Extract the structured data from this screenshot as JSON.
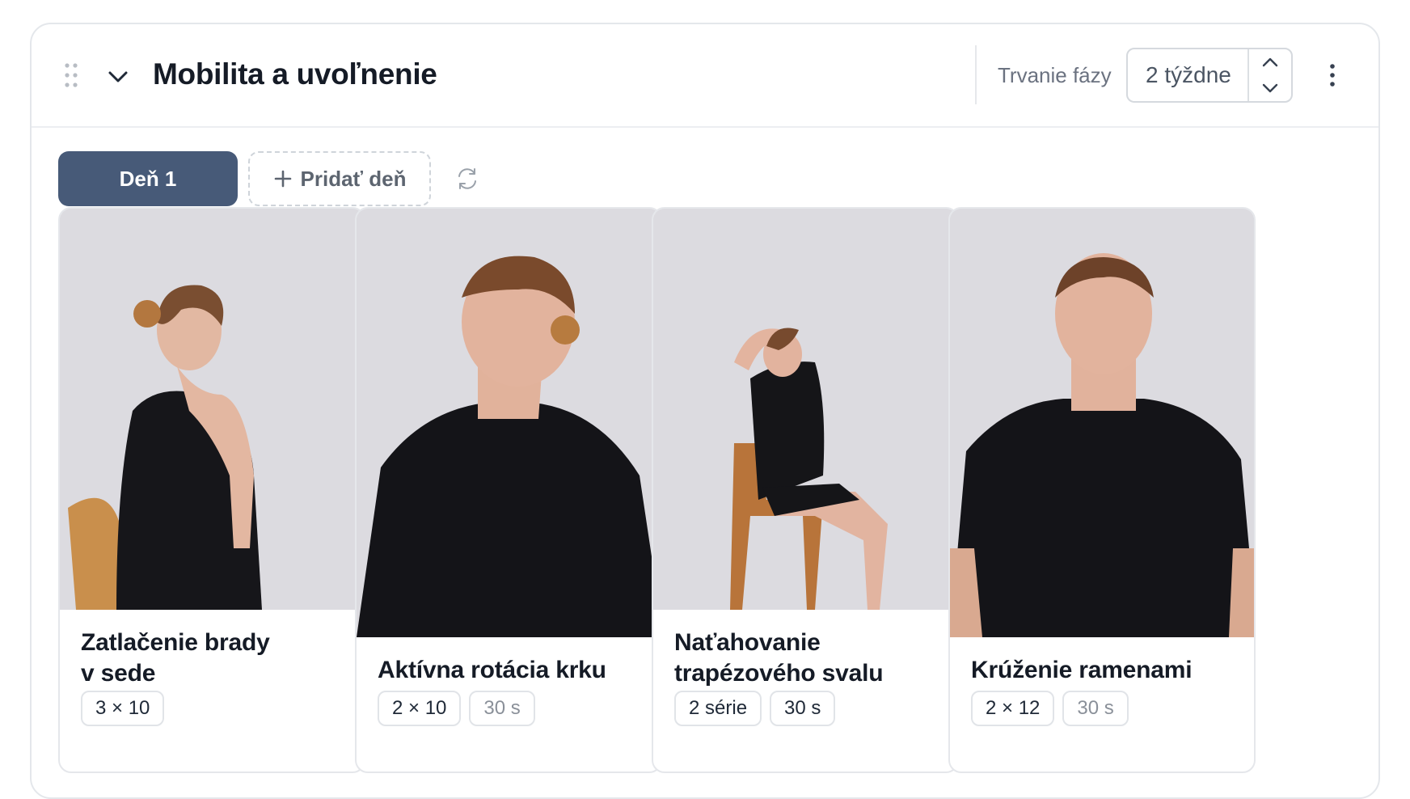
{
  "phase": {
    "title": "Mobilita a uvoľnenie",
    "duration_label": "Trvanie fázy",
    "duration_value": "2 týždne"
  },
  "days": {
    "active_day": "Deň 1",
    "add_day_label": "Pridať deň"
  },
  "icons": {
    "drag": "drag-handle-icon",
    "collapse": "chevron-down-icon",
    "increment": "chevron-up-icon",
    "decrement": "chevron-down-icon",
    "more": "more-vertical-icon",
    "add": "plus-icon",
    "refresh": "refresh-icon"
  },
  "colors": {
    "active_day_bg": "#475a78",
    "photo_bg": "#dcdbe0"
  },
  "exercises": [
    {
      "name_line1": "Zatlačenie brady",
      "name_line2": "v sede",
      "chips": [
        "3 × 10"
      ]
    },
    {
      "name_line1": "Aktívna rotácia krku",
      "name_line2": "",
      "chips": [
        "2 × 10",
        "30 s"
      ]
    },
    {
      "name_line1": "Naťahovanie",
      "name_line2": "trapézového svalu",
      "chips": [
        "2 série",
        "30 s"
      ]
    },
    {
      "name_line1": "Krúženie ramenami",
      "name_line2": "",
      "chips": [
        "2 × 12",
        "30 s"
      ]
    }
  ]
}
